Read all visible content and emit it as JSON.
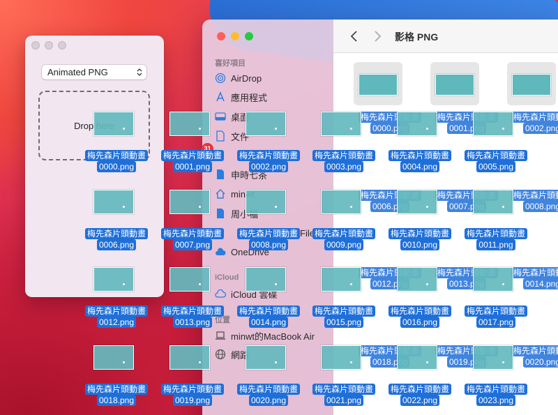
{
  "app": {
    "format_select": "Animated PNG",
    "drop_prompt": "Drop here"
  },
  "finder": {
    "title": "影格 PNG",
    "badge_count": "31",
    "favorites_header": "喜好項目",
    "icloud_header": "iCloud",
    "locations_header": "位置",
    "sidebar": [
      {
        "label": "AirDrop",
        "icon": "airdrop-icon"
      },
      {
        "label": "應用程式",
        "icon": "applications-icon"
      },
      {
        "label": "桌面",
        "icon": "desktop-icon"
      },
      {
        "label": "文件",
        "icon": "document-icon"
      },
      {
        "label": "申時七茶",
        "icon": "document-icon"
      },
      {
        "label": "minwt",
        "icon": "home-icon"
      },
      {
        "label": "周小福",
        "icon": "document-icon"
      },
      {
        "label": "File",
        "icon": "folder-icon"
      },
      {
        "label": "OneDrive",
        "icon": "cloud-icon"
      },
      {
        "label": "iCloud 雲碟",
        "icon": "icloud-icon"
      },
      {
        "label": "minwt的MacBook Air",
        "icon": "laptop-icon"
      },
      {
        "label": "網路",
        "icon": "globe-icon"
      }
    ]
  },
  "drag_files": [
    {
      "prefix": "梅先森片頭動畫",
      "name": "0000.png"
    },
    {
      "prefix": "梅先森片頭動畫",
      "name": "0001.png"
    },
    {
      "prefix": "梅先森片頭動畫",
      "name": "0002.png"
    },
    {
      "prefix": "梅先森片頭動畫",
      "name": "0003.png"
    },
    {
      "prefix": "梅先森片頭動畫",
      "name": "0004.png"
    },
    {
      "prefix": "梅先森片頭動畫",
      "name": "0005.png"
    },
    {
      "prefix": "梅先森片頭動畫",
      "name": "0006.png"
    },
    {
      "prefix": "梅先森片頭動畫",
      "name": "0007.png"
    },
    {
      "prefix": "梅先森片頭動畫",
      "name": "0008.png"
    },
    {
      "prefix": "梅先森片頭動畫",
      "name": "0009.png"
    },
    {
      "prefix": "梅先森片頭動畫",
      "name": "0010.png"
    },
    {
      "prefix": "梅先森片頭動畫",
      "name": "0011.png"
    },
    {
      "prefix": "梅先森片頭動畫",
      "name": "0012.png"
    },
    {
      "prefix": "梅先森片頭動畫",
      "name": "0013.png"
    },
    {
      "prefix": "梅先森片頭動畫",
      "name": "0014.png"
    },
    {
      "prefix": "梅先森片頭動畫",
      "name": "0015.png"
    },
    {
      "prefix": "梅先森片頭動畫",
      "name": "0016.png"
    },
    {
      "prefix": "梅先森片頭動畫",
      "name": "0017.png"
    },
    {
      "prefix": "梅先森片頭動畫",
      "name": "0018.png"
    },
    {
      "prefix": "梅先森片頭動畫",
      "name": "0019.png"
    },
    {
      "prefix": "梅先森片頭動畫",
      "name": "0020.png"
    },
    {
      "prefix": "梅先森片頭動畫",
      "name": "0021.png"
    },
    {
      "prefix": "梅先森片頭動畫",
      "name": "0022.png"
    },
    {
      "prefix": "梅先森片頭動畫",
      "name": "0023.png"
    }
  ],
  "finder_grid_files": [
    {
      "prefix": "梅先森片頭動畫",
      "name": "0000.png"
    },
    {
      "prefix": "梅先森片頭動畫",
      "name": "0001.png"
    },
    {
      "prefix": "梅先森片頭動畫",
      "name": "0002.png"
    },
    {
      "prefix": "梅先森片頭動畫",
      "name": "0006.png"
    },
    {
      "prefix": "梅先森片頭動畫",
      "name": "0007.png"
    },
    {
      "prefix": "梅先森片頭動畫",
      "name": "0008.png"
    },
    {
      "prefix": "梅先森片頭動畫",
      "name": "0012.png"
    },
    {
      "prefix": "梅先森片頭動畫",
      "name": "0013.png"
    },
    {
      "prefix": "梅先森片頭動畫",
      "name": "0014.png"
    },
    {
      "prefix": "梅先森片頭動畫",
      "name": "0018.png"
    },
    {
      "prefix": "梅先森片頭動畫",
      "name": "0019.png"
    },
    {
      "prefix": "梅先森片頭動畫",
      "name": "0020.png"
    }
  ]
}
